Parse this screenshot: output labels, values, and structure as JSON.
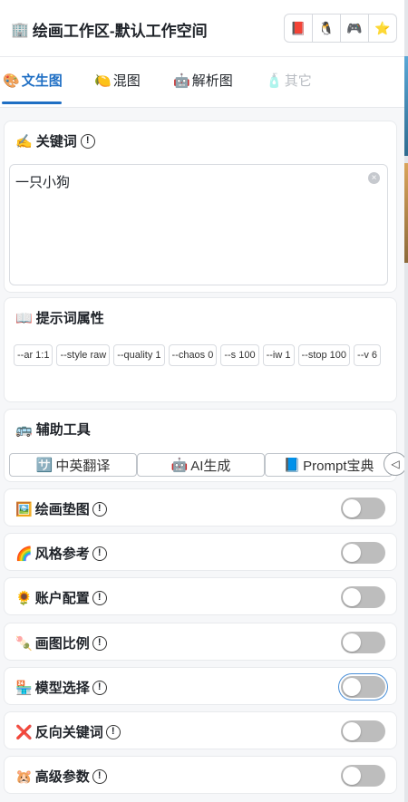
{
  "header": {
    "title": "绘画工作区-默认工作空间",
    "title_icon": "🏢",
    "buttons": [
      {
        "name": "notebook-icon",
        "glyph": "📕"
      },
      {
        "name": "qq-icon",
        "glyph": "🐧"
      },
      {
        "name": "discord-icon",
        "glyph": "🎮"
      },
      {
        "name": "star-icon",
        "glyph": "⭐"
      }
    ]
  },
  "tabs": [
    {
      "icon": "🎨",
      "label": "文生图",
      "state": "active"
    },
    {
      "icon": "🍋",
      "label": "混图",
      "state": "normal"
    },
    {
      "icon": "🤖",
      "label": "解析图",
      "state": "normal"
    },
    {
      "icon": "🧴",
      "label": "其它",
      "state": "disabled"
    }
  ],
  "keywords": {
    "icon": "✍️",
    "title": "关键词",
    "info": "!",
    "value": "一只小狗",
    "clear": "×"
  },
  "prompt_attrs": {
    "icon": "📖",
    "title": "提示词属性",
    "tags": [
      "--ar 1:1",
      "--style raw",
      "--quality 1",
      "--chaos 0",
      "--s 100",
      "--iw 1",
      "--stop 100",
      "--v 6"
    ]
  },
  "tools": {
    "icon": "🚌",
    "title": "辅助工具",
    "items": [
      {
        "icon": "🈂️",
        "label": "中英翻译"
      },
      {
        "icon": "🤖",
        "label": "AI生成"
      },
      {
        "icon": "📘",
        "label": "Prompt宝典"
      }
    ],
    "arrow": "◁"
  },
  "settings": [
    {
      "icon": "🖼️",
      "label": "绘画垫图",
      "on": false
    },
    {
      "icon": "🌈",
      "label": "风格参考",
      "on": false
    },
    {
      "icon": "🌻",
      "label": "账户配置",
      "on": false
    },
    {
      "icon": "🍡",
      "label": "画图比例",
      "on": false
    },
    {
      "icon": "🏪",
      "label": "模型选择",
      "on": false
    },
    {
      "icon": "❌",
      "label": "反向关键词",
      "on": false
    },
    {
      "icon": "🐹",
      "label": "高级参数",
      "on": false
    }
  ]
}
